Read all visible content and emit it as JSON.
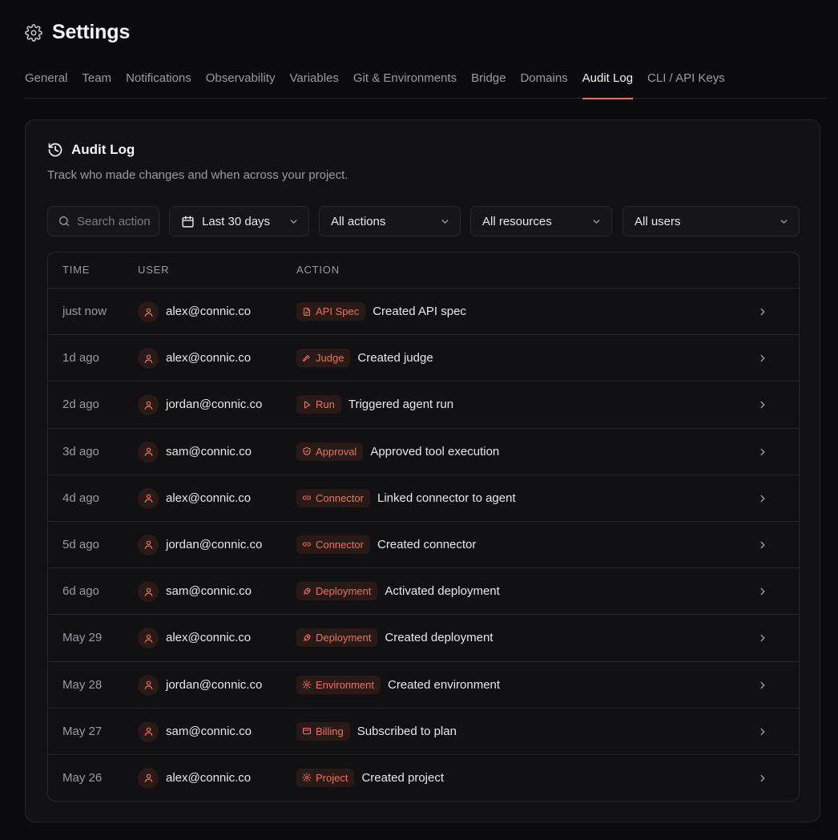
{
  "header": {
    "icon": "gear-icon",
    "title": "Settings"
  },
  "tabs": [
    {
      "label": "General",
      "active": false
    },
    {
      "label": "Team",
      "active": false
    },
    {
      "label": "Notifications",
      "active": false
    },
    {
      "label": "Observability",
      "active": false
    },
    {
      "label": "Variables",
      "active": false
    },
    {
      "label": "Git & Environments",
      "active": false
    },
    {
      "label": "Bridge",
      "active": false
    },
    {
      "label": "Domains",
      "active": false
    },
    {
      "label": "Audit Log",
      "active": true
    },
    {
      "label": "CLI / API Keys",
      "active": false
    }
  ],
  "card": {
    "icon": "history-icon",
    "title": "Audit Log",
    "subtitle": "Track who made changes and when across your project."
  },
  "filters": {
    "search_placeholder": "Search actions",
    "date_range": "Last 30 days",
    "actions": "All actions",
    "resources": "All resources",
    "users": "All users"
  },
  "table": {
    "columns": {
      "time": "TIME",
      "user": "USER",
      "action": "ACTION"
    },
    "rows": [
      {
        "time": "just now",
        "user": "alex@connic.co",
        "badge": "API Spec",
        "badge_icon": "file-icon",
        "action": "Created API spec"
      },
      {
        "time": "1d ago",
        "user": "alex@connic.co",
        "badge": "Judge",
        "badge_icon": "gavel-icon",
        "action": "Created judge"
      },
      {
        "time": "2d ago",
        "user": "jordan@connic.co",
        "badge": "Run",
        "badge_icon": "play-icon",
        "action": "Triggered agent run"
      },
      {
        "time": "3d ago",
        "user": "sam@connic.co",
        "badge": "Approval",
        "badge_icon": "shield-check-icon",
        "action": "Approved tool execution"
      },
      {
        "time": "4d ago",
        "user": "alex@connic.co",
        "badge": "Connector",
        "badge_icon": "link-icon",
        "action": "Linked connector to agent"
      },
      {
        "time": "5d ago",
        "user": "jordan@connic.co",
        "badge": "Connector",
        "badge_icon": "link-icon",
        "action": "Created connector"
      },
      {
        "time": "6d ago",
        "user": "sam@connic.co",
        "badge": "Deployment",
        "badge_icon": "rocket-icon",
        "action": "Activated deployment"
      },
      {
        "time": "May 29",
        "user": "alex@connic.co",
        "badge": "Deployment",
        "badge_icon": "rocket-icon",
        "action": "Created deployment"
      },
      {
        "time": "May 28",
        "user": "jordan@connic.co",
        "badge": "Environment",
        "badge_icon": "gear-icon",
        "action": "Created environment"
      },
      {
        "time": "May 27",
        "user": "sam@connic.co",
        "badge": "Billing",
        "badge_icon": "credit-card-icon",
        "action": "Subscribed to plan"
      },
      {
        "time": "May 26",
        "user": "alex@connic.co",
        "badge": "Project",
        "badge_icon": "gear-icon",
        "action": "Created project"
      }
    ]
  },
  "colors": {
    "accent": "#e8735a",
    "background": "#0b0b0d",
    "card": "#121215",
    "border": "#26262b"
  }
}
